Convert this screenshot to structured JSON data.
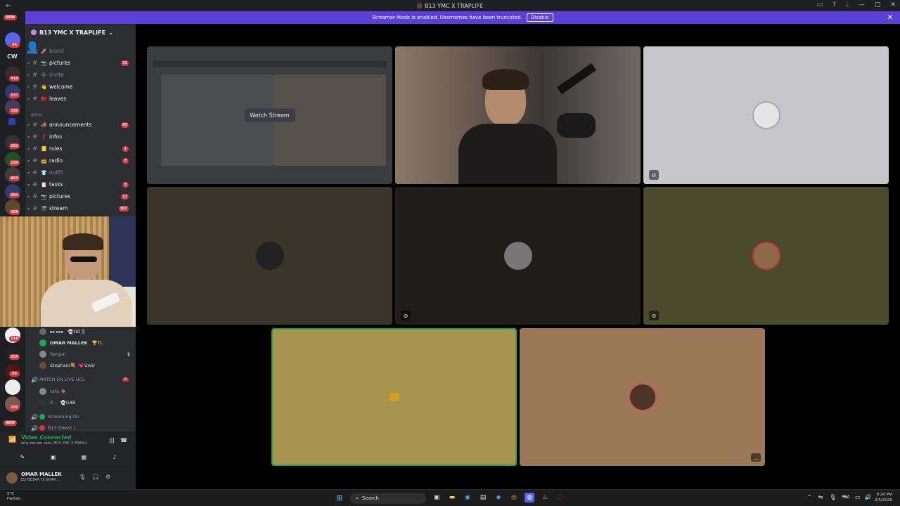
{
  "titlebar": {
    "title": "B13 YMC X TRAPLIFE",
    "back": "←"
  },
  "banner": {
    "message": "Streamer Mode is enabled. Usernames have been truncated.",
    "disable_label": "Disable",
    "close": "✕"
  },
  "rail": {
    "new_label": "NEW",
    "cw_label": "CW",
    "badges": [
      "56",
      "410",
      "137",
      "335",
      "292",
      "334",
      "663",
      "593",
      "409",
      "116",
      "304",
      "64",
      "255"
    ],
    "bottom_new": "NEW"
  },
  "server": {
    "name": "B13 YMC X TRAPLIFE"
  },
  "channels_top": [
    {
      "emoji": "🚀",
      "label": "boost",
      "muted": true,
      "count": ""
    },
    {
      "emoji": "📷",
      "label": "pictures",
      "muted": false,
      "count": "12"
    },
    {
      "emoji": "➕",
      "label": "invite",
      "muted": true,
      "count": ""
    },
    {
      "emoji": "👋",
      "label": "welcome",
      "muted": false,
      "count": ""
    },
    {
      "emoji": "🇲🇦",
      "label": "leaves",
      "muted": false,
      "count": ""
    }
  ],
  "category": {
    "label": "gang"
  },
  "channels_gang": [
    {
      "emoji": "📣",
      "label": "announcements",
      "muted": false,
      "count": "43"
    },
    {
      "emoji": "❗",
      "label": "infos",
      "muted": false,
      "count": ""
    },
    {
      "emoji": "📒",
      "label": "rules",
      "muted": false,
      "count": "1"
    },
    {
      "emoji": "📻",
      "label": "radio",
      "muted": false,
      "count": "7"
    },
    {
      "emoji": "👕",
      "label": "outfit",
      "muted": true,
      "count": ""
    },
    {
      "emoji": "📋",
      "label": "tasks",
      "muted": false,
      "count": "3"
    },
    {
      "emoji": "📷",
      "label": "pictures",
      "muted": false,
      "count": "11"
    },
    {
      "emoji": "🎬",
      "label": "stream",
      "muted": false,
      "count": "307"
    }
  ],
  "voice_members": [
    {
      "name": "ꭰꭰ ꭰꭰꭰ",
      "tag": "👻DD🎗",
      "dim": false
    },
    {
      "name": "OMAR MALLEK",
      "tag": "🏆TL",
      "dim": false
    },
    {
      "name": "Senpai",
      "tag": "",
      "dim": true
    },
    {
      "name": "Stephani💐",
      "tag": "💗UwU",
      "dim": false
    }
  ],
  "voice_channel_2": {
    "label": "MATCH EN LIVE UCL",
    "count": "1"
  },
  "voice_members_2": [
    {
      "name": "rafa 🐐",
      "tag": ""
    },
    {
      "name": "X...",
      "tag": "👻G4B"
    }
  ],
  "voice_channel_3": {
    "label": "Streaming On"
  },
  "voice_channel_4": {
    "label": "B13 GANG |"
  },
  "vc_panel": {
    "status": "Video Connected",
    "sub": "only zok om valo / B13 YMC X TRAPLI...",
    "camera_icon": "✎",
    "share_icon": "▣",
    "activity_icon": "▦",
    "soundboard_icon": "♪"
  },
  "user_panel": {
    "name": "OMAR MALLEK",
    "status": "ELI BE3NA YJI NHAR ..."
  },
  "stream_tile": {
    "watch_label": "Watch Stream"
  },
  "taskbar": {
    "weather_temp": "5°C",
    "weather_desc": "Fwlhds",
    "search_label": "Search",
    "lang": "FRA",
    "time": "9:20 PM",
    "date": "2/5/2026"
  },
  "colors": {
    "accent": "#5c3fd6",
    "tile_grey": "#c7c7c9",
    "tile_dark_olive": "#3a3528",
    "tile_dark": "#1f1c1a",
    "tile_olive": "#4b4a2c",
    "tile_mustard": "#a6944f",
    "tile_tan": "#9a7858",
    "speaking_border": "#23a55a"
  }
}
